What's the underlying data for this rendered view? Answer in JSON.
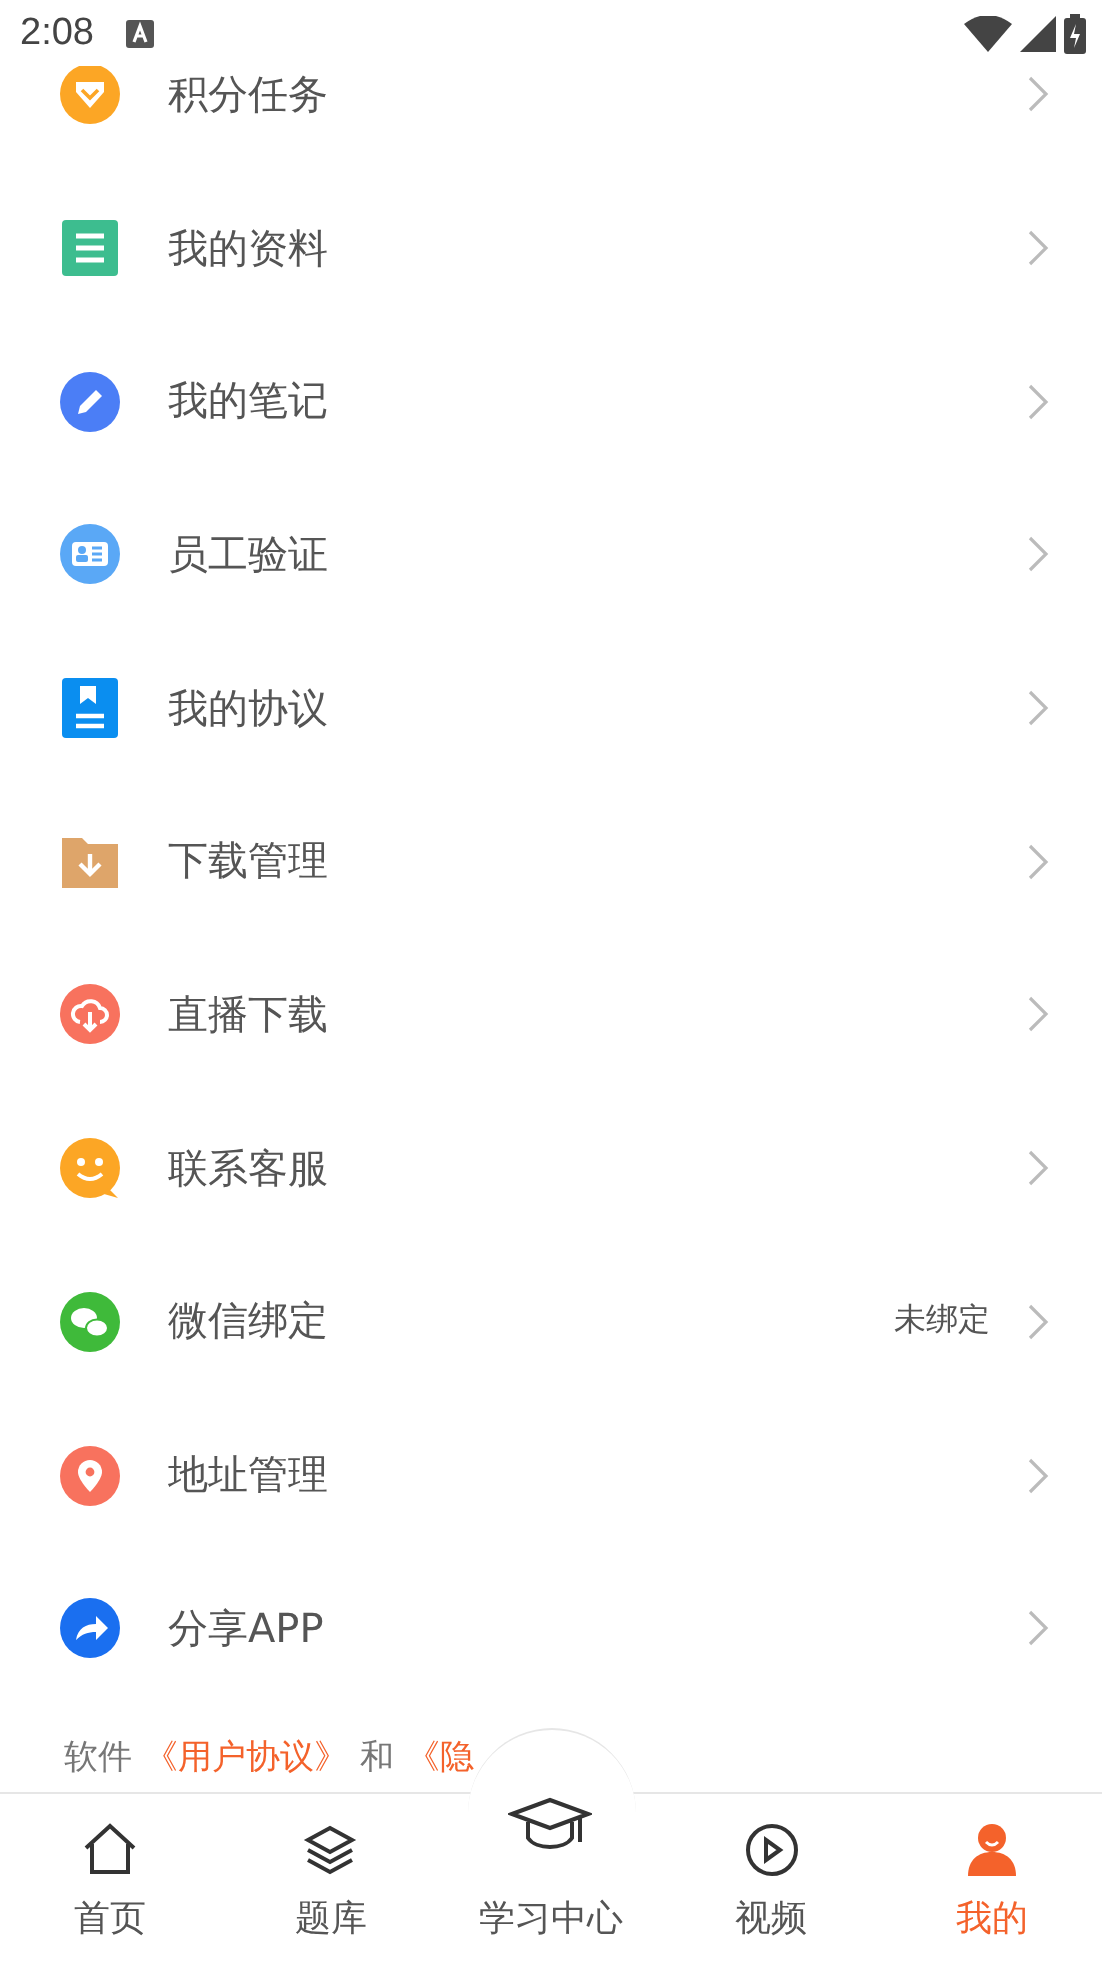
{
  "status_bar": {
    "time": "2:08"
  },
  "menu": [
    {
      "label": "积分任务"
    },
    {
      "label": "我的资料"
    },
    {
      "label": "我的笔记"
    },
    {
      "label": "员工验证"
    },
    {
      "label": "我的协议"
    },
    {
      "label": "下载管理"
    },
    {
      "label": "直播下载"
    },
    {
      "label": "联系客服"
    },
    {
      "label": "微信绑定",
      "value": "未绑定"
    },
    {
      "label": "地址管理"
    },
    {
      "label": "分享APP"
    }
  ],
  "footer": {
    "parts": [
      {
        "text": "软件",
        "link": false
      },
      {
        "text": "《用户协议》",
        "link": true
      },
      {
        "text": "和",
        "link": false
      },
      {
        "text": "《隐",
        "link": true
      }
    ]
  },
  "tab_bar": [
    {
      "label": "首页",
      "selected": false,
      "kind": "normal"
    },
    {
      "label": "题库",
      "selected": false,
      "kind": "normal"
    },
    {
      "label": "学习中心",
      "selected": false,
      "kind": "raised"
    },
    {
      "label": "视频",
      "selected": false,
      "kind": "normal"
    },
    {
      "label": "我的",
      "selected": true,
      "kind": "normal"
    }
  ]
}
